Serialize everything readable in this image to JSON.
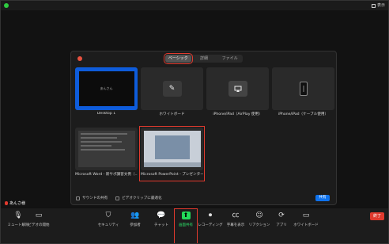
{
  "window": {
    "view_label": "表示"
  },
  "dialog": {
    "tabs": [
      {
        "label": "ベーシック",
        "active": true
      },
      {
        "label": "詳細",
        "active": false
      },
      {
        "label": "ファイル",
        "active": false
      }
    ],
    "tiles": [
      {
        "caption": "Desktop 1",
        "thumb_text": "あんさん"
      },
      {
        "caption": "ホワイトボード",
        "icon": "pen-icon"
      },
      {
        "caption": "iPhone/iPad（AirPlay 使用）",
        "icon": "airplay-icon"
      },
      {
        "caption": "iPhone/iPad（ケーブル使用）",
        "icon": "phone-cable-icon"
      },
      {
        "caption": "Microsoft Word - 新サポ講習文例（..."
      },
      {
        "caption": "Microsoft PowerPoint - プレゼンター..."
      }
    ],
    "footer": {
      "sound_label": "サウンドの共有",
      "video_label": "ビデオクリップに最適化",
      "share_button": "共有"
    }
  },
  "user": {
    "name": "あんさ様"
  },
  "toolbar": {
    "items": [
      {
        "label": "ミュート解除",
        "icon": "mic-muted-icon"
      },
      {
        "label": "ビデオの開始",
        "icon": "video-off-icon"
      },
      {
        "label": "セキュリティ",
        "icon": "shield-icon"
      },
      {
        "label": "参加者",
        "icon": "participants-icon"
      },
      {
        "label": "チャット",
        "icon": "chat-icon"
      },
      {
        "label": "画面共有",
        "icon": "share-screen-icon"
      },
      {
        "label": "レコーディング",
        "icon": "record-icon"
      },
      {
        "label": "字幕を表示",
        "icon": "cc-icon"
      },
      {
        "label": "リアクション",
        "icon": "reaction-icon"
      },
      {
        "label": "アプリ",
        "icon": "apps-icon"
      },
      {
        "label": "ホワイトボード",
        "icon": "whiteboard-icon"
      }
    ],
    "end_button": "終了"
  },
  "colors": {
    "accent_blue": "#0e72ed",
    "share_green": "#23d959",
    "end_red": "#e03a2e",
    "highlight_red": "#e03a2e"
  }
}
